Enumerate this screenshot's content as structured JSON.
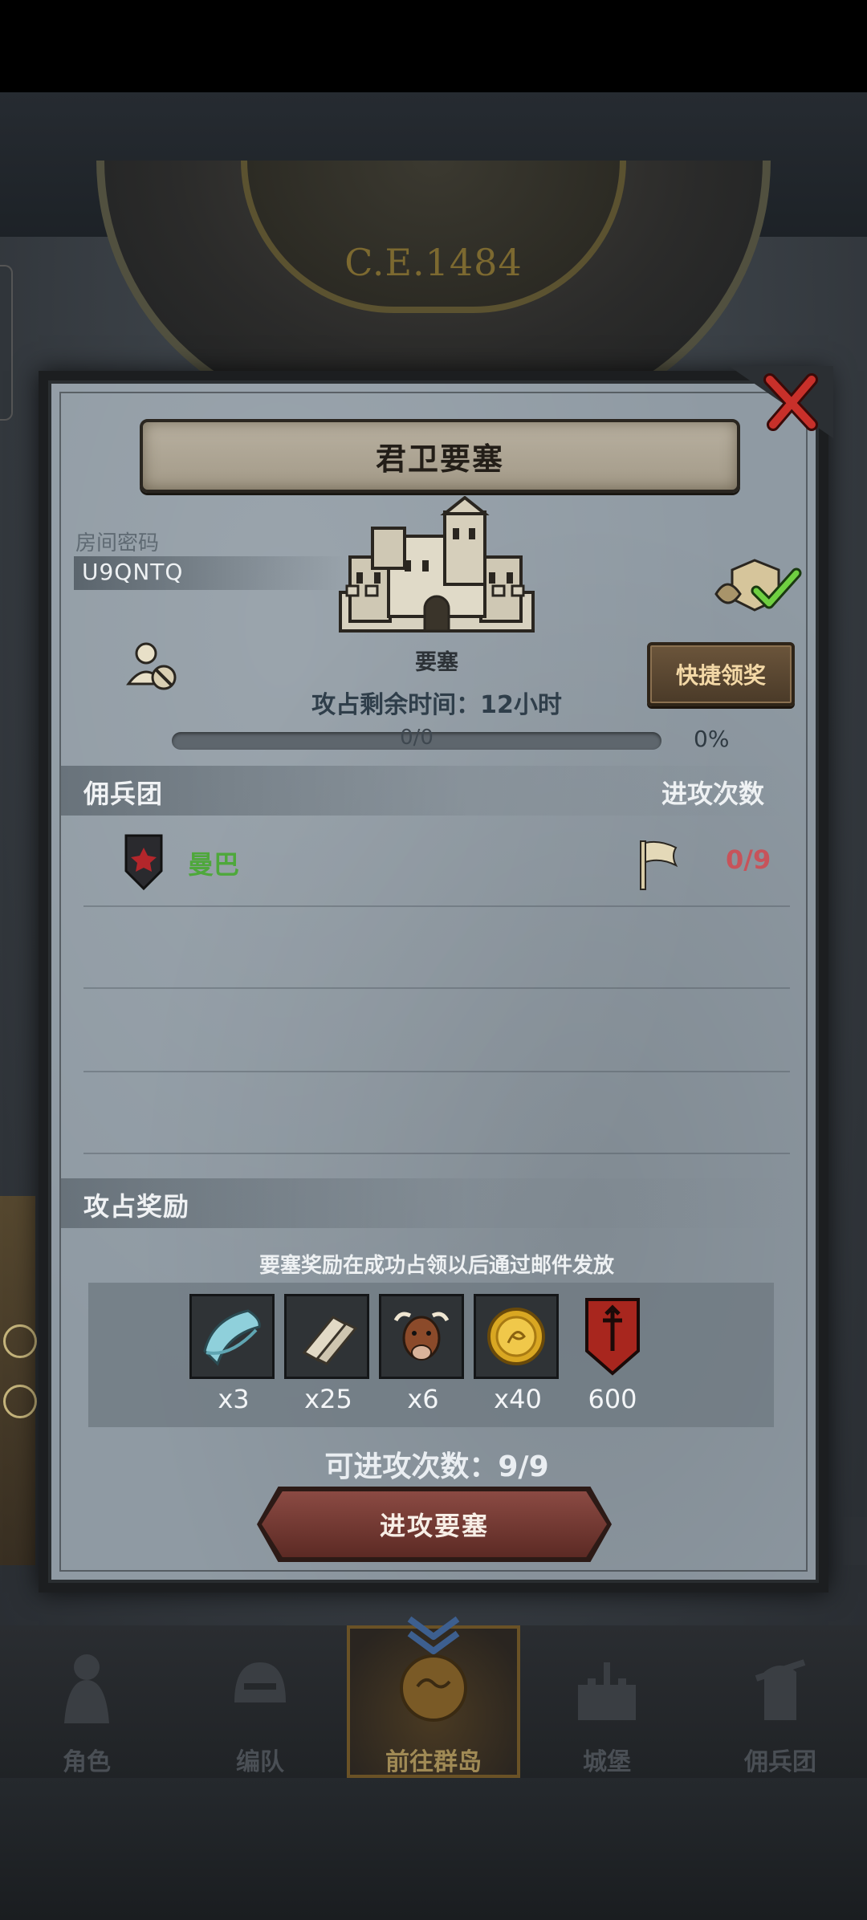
{
  "background": {
    "era_text": "C.E.1484"
  },
  "dialog": {
    "title": "君卫要塞",
    "room": {
      "label": "房间密码",
      "code": "U9QNTQ"
    },
    "fortress": {
      "type_label": "要塞",
      "occupy_time_label": "攻占剩余时间：",
      "occupy_time_value": "12小时"
    },
    "quick_claim_label": "快捷领奖",
    "progress": {
      "text": "0/0",
      "percent_label": "0%",
      "fraction": 0
    },
    "mercenary_section": {
      "title": "佣兵团",
      "attack_count_header": "进攻次数"
    },
    "mercenaries": [
      {
        "name": "曼巴",
        "attacks": "0/9",
        "name_color": "#4ea83b",
        "count_color": "#c7535a"
      }
    ],
    "reward_section": {
      "title": "攻占奖励",
      "note": "要塞奖励在成功占领以后通过邮件发放"
    },
    "rewards": [
      {
        "icon": "cloth-icon",
        "qty": "x3"
      },
      {
        "icon": "scroll-icon",
        "qty": "x25"
      },
      {
        "icon": "cow-icon",
        "qty": "x6"
      },
      {
        "icon": "gold-coin-icon",
        "qty": "x40"
      },
      {
        "icon": "guild-banner-icon",
        "qty": "600"
      }
    ],
    "attacks_left": {
      "label": "可进攻次数：",
      "value": "9/9"
    },
    "attack_button_label": "进攻要塞"
  },
  "bottom_nav": {
    "items": [
      {
        "label": "角色",
        "icon": "knight-icon",
        "active": false
      },
      {
        "label": "编队",
        "icon": "helmet-icon",
        "active": false
      },
      {
        "label": "前往群岛",
        "icon": "map-icon",
        "active": true
      },
      {
        "label": "城堡",
        "icon": "castle-icon",
        "active": false
      },
      {
        "label": "佣兵团",
        "icon": "mercenary-icon",
        "active": false
      }
    ]
  },
  "colors": {
    "dialog_bg": "#8f9aa3",
    "accent_green": "#4ea83b",
    "accent_red": "#c7535a",
    "attack_button": "#8b4a43",
    "title_banner": "#b8b0a0"
  }
}
